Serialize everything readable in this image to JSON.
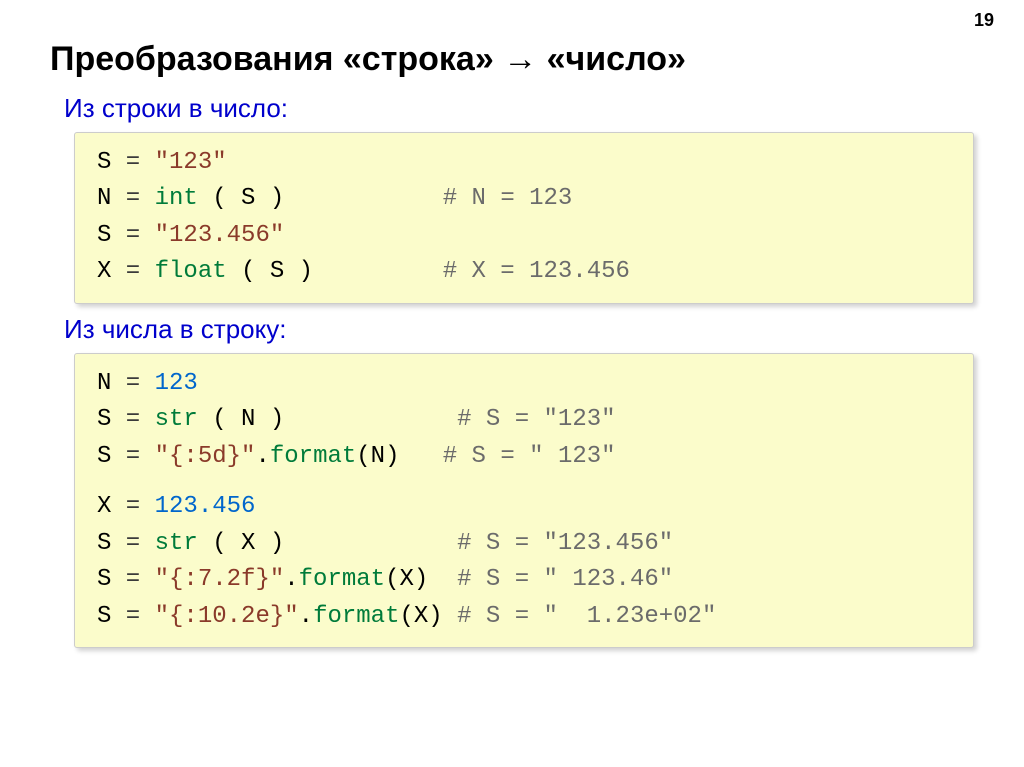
{
  "page_number": "19",
  "title_parts": {
    "pre": "Преобразования «строка» ",
    "arrow": "→",
    "post": " «число»"
  },
  "subtitle1": "Из строки в число:",
  "subtitle2": "Из числа в строку:",
  "box1": {
    "l1": {
      "lhs": "S",
      "eq": " = ",
      "val": "\"123\""
    },
    "l2": {
      "lhs": "N",
      "eq": " = ",
      "fn": "int",
      "args": " ( S )",
      "pad": "           ",
      "cm": "# N = 123"
    },
    "l3": {
      "lhs": "S",
      "eq": " = ",
      "val": "\"123.456\""
    },
    "l4": {
      "lhs": "X",
      "eq": " = ",
      "fn": "float",
      "args": " ( S )",
      "pad": "         ",
      "cm": "# X = 123.456"
    }
  },
  "box2": {
    "l1": {
      "lhs": "N",
      "eq": " = ",
      "val": "123"
    },
    "l2": {
      "lhs": "S",
      "eq": " = ",
      "fn": "str",
      "args": " ( N )",
      "pad": "            ",
      "cm": "# S = \"123\""
    },
    "l3": {
      "lhs": "S",
      "eq": " = ",
      "str": "\"{:5d}\"",
      "dot": ".",
      "fn": "format",
      "args": "(N)",
      "pad": "   ",
      "cm": "# S = \" 123\""
    },
    "l4": {
      "lhs": "X",
      "eq": " = ",
      "val": "123.456"
    },
    "l5": {
      "lhs": "S",
      "eq": " = ",
      "fn": "str",
      "args": " ( X )",
      "pad": "            ",
      "cm": "# S = \"123.456\""
    },
    "l6": {
      "lhs": "S",
      "eq": " = ",
      "str": "\"{:7.2f}\"",
      "dot": ".",
      "fn": "format",
      "args": "(X)",
      "pad": "  ",
      "cm": "# S = \" 123.46\""
    },
    "l7": {
      "lhs": "S",
      "eq": " = ",
      "str": "\"{:10.2e}\"",
      "dot": ".",
      "fn": "format",
      "args": "(X)",
      "pad": " ",
      "cm": "# S = \"  1.23e+02\""
    }
  }
}
